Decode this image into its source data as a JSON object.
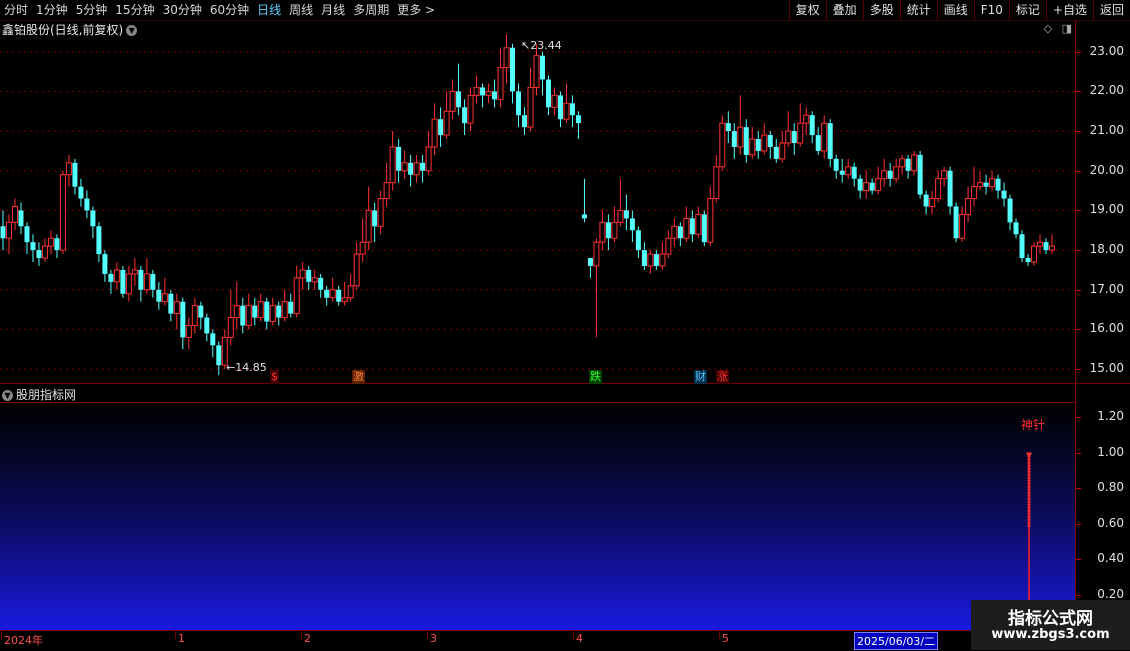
{
  "toolbar": {
    "periods": [
      "分时",
      "1分钟",
      "5分钟",
      "15分钟",
      "30分钟",
      "60分钟",
      "日线",
      "周线",
      "月线",
      "多周期",
      "更多 >"
    ],
    "active_period": "日线",
    "buttons": [
      "复权",
      "叠加",
      "多股",
      "统计",
      "画线",
      "F10",
      "标记",
      "+自选",
      "返回"
    ]
  },
  "header": {
    "stock_title": "鑫铂股份(日线,前复权)",
    "corner_icons": [
      "diamond-icon",
      "panel-toggle-icon"
    ]
  },
  "price_axis": {
    "labels": [
      "23.00",
      "22.00",
      "21.00",
      "20.00",
      "19.00",
      "18.00",
      "17.00",
      "16.00",
      "15.00"
    ]
  },
  "high_low": {
    "high": "23.44",
    "low": "14.85"
  },
  "events": [
    {
      "text": "$",
      "color": "#ff3030"
    },
    {
      "text": "激",
      "color": "#ff8040"
    },
    {
      "text": "跌",
      "color": "#30ff30"
    },
    {
      "text": "财",
      "color": "#60c0ff"
    },
    {
      "text": "涨",
      "color": "#ff3030"
    }
  ],
  "indicator": {
    "title": "股朋指标网",
    "axis_labels": [
      "1.20",
      "1.00",
      "0.80",
      "0.60",
      "0.40",
      "0.20"
    ],
    "signal_label": "神针",
    "signal_value": 1.0
  },
  "date_bar": {
    "labels": [
      "2024年",
      "1",
      "2",
      "3",
      "4",
      "5"
    ],
    "cursor_date": "2025/06/03/二"
  },
  "watermark": {
    "line1": "指标公式网",
    "line2": "www.zbgs3.com"
  },
  "colors": {
    "up": "#ff3030",
    "down": "#54ffff",
    "frame": "#7a0000",
    "bg": "#000000"
  },
  "chart_data": {
    "type": "candlestick",
    "ylim": [
      14.6,
      23.8
    ],
    "candles": [
      [
        18.6,
        18.3,
        19.0,
        18.0
      ],
      [
        18.3,
        18.7,
        18.9,
        17.9
      ],
      [
        18.7,
        19.1,
        19.3,
        18.5
      ],
      [
        19.0,
        18.6,
        19.2,
        18.4
      ],
      [
        18.6,
        18.2,
        18.7,
        17.9
      ],
      [
        18.2,
        18.0,
        18.4,
        17.7
      ],
      [
        18.0,
        17.8,
        18.2,
        17.6
      ],
      [
        17.8,
        18.1,
        18.3,
        17.7
      ],
      [
        18.1,
        18.3,
        18.5,
        17.9
      ],
      [
        18.3,
        18.0,
        18.4,
        17.8
      ],
      [
        18.0,
        19.9,
        20.0,
        17.9
      ],
      [
        19.9,
        20.2,
        20.4,
        19.6
      ],
      [
        20.2,
        19.6,
        20.3,
        19.4
      ],
      [
        19.6,
        19.3,
        19.8,
        19.1
      ],
      [
        19.3,
        19.0,
        19.5,
        18.8
      ],
      [
        19.0,
        18.6,
        19.1,
        18.3
      ],
      [
        18.6,
        17.9,
        18.7,
        17.7
      ],
      [
        17.9,
        17.4,
        18.0,
        17.2
      ],
      [
        17.4,
        17.2,
        17.5,
        16.9
      ],
      [
        17.2,
        17.5,
        17.7,
        17.0
      ],
      [
        17.5,
        16.9,
        17.6,
        16.8
      ],
      [
        16.9,
        17.4,
        17.6,
        16.7
      ],
      [
        17.4,
        17.5,
        17.8,
        17.1
      ],
      [
        17.5,
        17.0,
        17.6,
        16.7
      ],
      [
        17.0,
        17.4,
        17.8,
        16.9
      ],
      [
        17.4,
        17.0,
        17.5,
        16.8
      ],
      [
        17.0,
        16.7,
        17.2,
        16.5
      ],
      [
        16.7,
        16.9,
        17.3,
        16.6
      ],
      [
        16.9,
        16.4,
        17.0,
        16.2
      ],
      [
        16.4,
        16.7,
        16.9,
        16.0
      ],
      [
        16.7,
        15.8,
        16.8,
        15.5
      ],
      [
        15.8,
        16.1,
        16.3,
        15.5
      ],
      [
        16.1,
        16.6,
        16.8,
        15.9
      ],
      [
        16.6,
        16.3,
        16.7,
        16.0
      ],
      [
        16.3,
        15.9,
        16.4,
        15.7
      ],
      [
        15.9,
        15.6,
        16.0,
        15.3
      ],
      [
        15.6,
        15.1,
        15.7,
        14.85
      ],
      [
        15.1,
        15.8,
        16.0,
        15.0
      ],
      [
        15.8,
        16.3,
        17.0,
        15.6
      ],
      [
        16.3,
        16.6,
        17.2,
        16.0
      ],
      [
        16.6,
        16.1,
        16.8,
        15.9
      ],
      [
        16.1,
        16.6,
        16.9,
        16.0
      ],
      [
        16.6,
        16.3,
        16.8,
        16.1
      ],
      [
        16.3,
        16.7,
        16.9,
        16.2
      ],
      [
        16.7,
        16.2,
        16.8,
        16.0
      ],
      [
        16.2,
        16.6,
        16.8,
        16.1
      ],
      [
        16.6,
        16.3,
        16.7,
        16.1
      ],
      [
        16.3,
        16.7,
        17.0,
        16.2
      ],
      [
        16.7,
        16.4,
        16.9,
        16.3
      ],
      [
        16.4,
        17.3,
        17.6,
        16.3
      ],
      [
        17.3,
        17.5,
        17.7,
        17.0
      ],
      [
        17.5,
        17.2,
        17.6,
        17.0
      ],
      [
        17.2,
        17.3,
        17.5,
        17.0
      ],
      [
        17.3,
        17.0,
        17.4,
        16.8
      ],
      [
        17.0,
        16.8,
        17.1,
        16.6
      ],
      [
        16.8,
        17.0,
        17.3,
        16.7
      ],
      [
        17.0,
        16.7,
        17.1,
        16.6
      ],
      [
        16.7,
        16.8,
        17.2,
        16.6
      ],
      [
        16.8,
        17.1,
        17.4,
        16.7
      ],
      [
        17.1,
        17.9,
        18.2,
        17.0
      ],
      [
        17.9,
        18.2,
        18.8,
        17.7
      ],
      [
        18.2,
        19.0,
        19.6,
        18.0
      ],
      [
        19.0,
        18.6,
        19.2,
        18.2
      ],
      [
        18.6,
        19.3,
        19.5,
        18.4
      ],
      [
        19.3,
        19.7,
        20.2,
        19.1
      ],
      [
        19.7,
        20.6,
        21.0,
        19.5
      ],
      [
        20.6,
        20.0,
        20.8,
        19.7
      ],
      [
        20.0,
        20.2,
        20.5,
        19.8
      ],
      [
        20.2,
        19.9,
        20.4,
        19.6
      ],
      [
        19.9,
        20.2,
        20.4,
        19.7
      ],
      [
        20.2,
        20.0,
        20.4,
        19.7
      ],
      [
        20.0,
        20.6,
        21.0,
        19.9
      ],
      [
        20.6,
        21.3,
        21.7,
        20.4
      ],
      [
        21.3,
        20.9,
        21.6,
        20.6
      ],
      [
        20.9,
        21.5,
        22.0,
        20.8
      ],
      [
        21.5,
        22.0,
        22.3,
        21.3
      ],
      [
        22.0,
        21.6,
        22.7,
        21.4
      ],
      [
        21.6,
        21.2,
        21.8,
        20.9
      ],
      [
        21.2,
        21.9,
        22.1,
        21.0
      ],
      [
        21.9,
        22.1,
        22.4,
        21.7
      ],
      [
        22.1,
        21.9,
        22.2,
        21.6
      ],
      [
        21.9,
        22.0,
        22.2,
        21.7
      ],
      [
        22.0,
        21.8,
        22.3,
        21.6
      ],
      [
        21.8,
        22.6,
        23.1,
        21.6
      ],
      [
        22.6,
        23.1,
        23.44,
        22.2
      ],
      [
        23.1,
        22.0,
        23.2,
        21.7
      ],
      [
        22.0,
        21.4,
        22.2,
        21.1
      ],
      [
        21.4,
        21.1,
        21.6,
        20.9
      ],
      [
        21.1,
        22.1,
        22.6,
        21.0
      ],
      [
        22.1,
        22.9,
        23.2,
        21.9
      ],
      [
        22.9,
        22.3,
        23.0,
        21.9
      ],
      [
        22.3,
        21.6,
        22.4,
        21.4
      ],
      [
        21.6,
        21.9,
        22.1,
        21.4
      ],
      [
        21.9,
        21.3,
        22.0,
        21.1
      ],
      [
        21.3,
        21.7,
        22.2,
        21.2
      ],
      [
        21.7,
        21.4,
        21.9,
        21.1
      ],
      [
        21.4,
        21.2,
        21.5,
        20.8
      ],
      [
        18.9,
        18.8,
        19.8,
        18.7
      ],
      [
        17.8,
        17.6,
        17.8,
        17.3
      ],
      [
        17.6,
        18.2,
        18.3,
        15.8
      ],
      [
        18.2,
        18.7,
        19.0,
        18.0
      ],
      [
        18.7,
        18.3,
        18.9,
        18.0
      ],
      [
        18.3,
        18.7,
        19.1,
        18.2
      ],
      [
        18.7,
        19.0,
        19.8,
        18.6
      ],
      [
        19.0,
        18.8,
        19.4,
        18.5
      ],
      [
        18.8,
        18.5,
        19.0,
        18.2
      ],
      [
        18.5,
        18.0,
        18.6,
        17.8
      ],
      [
        18.0,
        17.6,
        18.2,
        17.5
      ],
      [
        17.6,
        17.9,
        18.0,
        17.4
      ],
      [
        17.9,
        17.6,
        18.0,
        17.5
      ],
      [
        17.6,
        17.9,
        18.2,
        17.5
      ],
      [
        17.9,
        18.3,
        18.5,
        17.8
      ],
      [
        18.3,
        18.6,
        18.8,
        18.1
      ],
      [
        18.6,
        18.3,
        18.7,
        18.1
      ],
      [
        18.3,
        18.8,
        19.1,
        18.2
      ],
      [
        18.8,
        18.4,
        19.0,
        18.2
      ],
      [
        18.4,
        18.9,
        19.1,
        18.3
      ],
      [
        18.9,
        18.2,
        19.0,
        18.1
      ],
      [
        18.2,
        19.3,
        19.6,
        18.1
      ],
      [
        19.3,
        20.1,
        20.4,
        19.2
      ],
      [
        20.1,
        21.2,
        21.4,
        20.0
      ],
      [
        21.2,
        21.0,
        21.5,
        20.7
      ],
      [
        21.0,
        20.6,
        21.2,
        20.3
      ],
      [
        20.6,
        21.1,
        21.9,
        20.4
      ],
      [
        21.1,
        20.4,
        21.3,
        20.2
      ],
      [
        20.4,
        20.8,
        21.1,
        20.3
      ],
      [
        20.8,
        20.5,
        21.0,
        20.3
      ],
      [
        20.5,
        20.9,
        21.2,
        20.4
      ],
      [
        20.9,
        20.6,
        21.0,
        20.3
      ],
      [
        20.6,
        20.3,
        20.8,
        20.2
      ],
      [
        20.3,
        20.7,
        21.0,
        20.2
      ],
      [
        20.7,
        21.0,
        21.5,
        20.6
      ],
      [
        21.0,
        20.7,
        21.2,
        20.4
      ],
      [
        20.7,
        21.2,
        21.7,
        20.6
      ],
      [
        21.2,
        21.4,
        21.6,
        20.9
      ],
      [
        21.4,
        20.9,
        21.5,
        20.7
      ],
      [
        20.9,
        20.5,
        21.1,
        20.4
      ],
      [
        20.5,
        21.2,
        21.4,
        20.3
      ],
      [
        21.2,
        20.3,
        21.3,
        20.1
      ],
      [
        20.3,
        20.0,
        20.4,
        19.8
      ],
      [
        20.0,
        19.9,
        20.3,
        19.7
      ],
      [
        19.9,
        20.1,
        20.3,
        19.8
      ],
      [
        20.1,
        19.8,
        20.2,
        19.6
      ],
      [
        19.8,
        19.5,
        19.9,
        19.3
      ],
      [
        19.5,
        19.7,
        20.0,
        19.3
      ],
      [
        19.7,
        19.5,
        19.8,
        19.4
      ],
      [
        19.5,
        19.8,
        20.1,
        19.4
      ],
      [
        19.8,
        20.0,
        20.3,
        19.6
      ],
      [
        20.0,
        19.8,
        20.2,
        19.6
      ],
      [
        19.8,
        20.1,
        20.3,
        19.7
      ],
      [
        20.1,
        20.3,
        20.4,
        19.9
      ],
      [
        20.3,
        20.0,
        20.4,
        19.8
      ],
      [
        20.0,
        20.4,
        20.5,
        19.9
      ],
      [
        20.4,
        19.4,
        20.5,
        19.3
      ],
      [
        19.4,
        19.1,
        19.5,
        18.9
      ],
      [
        19.1,
        19.3,
        19.5,
        18.9
      ],
      [
        19.3,
        19.8,
        20.0,
        19.2
      ],
      [
        19.8,
        20.0,
        20.1,
        19.6
      ],
      [
        20.0,
        19.1,
        20.1,
        18.9
      ],
      [
        19.1,
        18.3,
        19.2,
        18.2
      ],
      [
        18.3,
        18.9,
        19.1,
        18.2
      ],
      [
        18.9,
        19.3,
        19.6,
        18.7
      ],
      [
        19.3,
        19.6,
        20.1,
        19.1
      ],
      [
        19.6,
        19.7,
        20.0,
        19.5
      ],
      [
        19.7,
        19.6,
        19.9,
        19.4
      ],
      [
        19.6,
        19.8,
        20.0,
        19.5
      ],
      [
        19.8,
        19.5,
        19.9,
        19.3
      ],
      [
        19.5,
        19.3,
        19.7,
        19.1
      ],
      [
        19.3,
        18.7,
        19.4,
        18.5
      ],
      [
        18.7,
        18.4,
        18.8,
        18.3
      ],
      [
        18.4,
        17.8,
        18.5,
        17.7
      ],
      [
        17.8,
        17.7,
        17.9,
        17.6
      ],
      [
        17.7,
        18.1,
        18.2,
        17.6
      ],
      [
        18.1,
        18.2,
        18.4,
        17.9
      ],
      [
        18.2,
        18.0,
        18.3,
        17.9
      ],
      [
        18.0,
        18.1,
        18.4,
        17.9
      ]
    ],
    "indicator_signal_index": -1
  }
}
